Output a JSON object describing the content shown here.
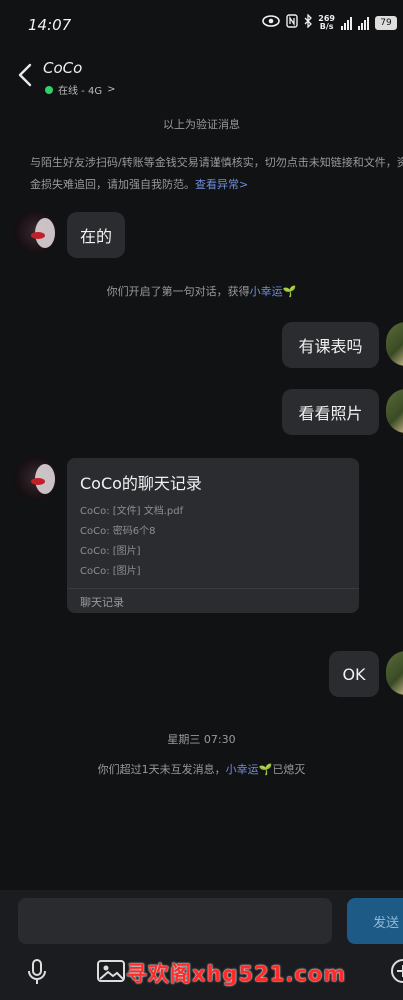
{
  "status": {
    "time": "14:07",
    "net_rate": "269",
    "net_unit": "B/s",
    "battery": "79"
  },
  "header": {
    "contact_name": "CoCo",
    "status_text": "在线 - 4G",
    "status_chevron": ">"
  },
  "messages": {
    "verify_notice": "以上为验证消息",
    "warning_text": "与陌生好友涉扫码/转账等金钱交易请谨慎核实，切勿点击未知链接和文件，资金损失难追回，请加强自我防范。",
    "warning_link": "查看异常>",
    "msg1": "在的",
    "first_chat_notice": "你们开启了第一句对话，获得",
    "lucky_label": "小幸运",
    "msg2": "有课表吗",
    "msg3": "看看照片",
    "card": {
      "title": "CoCo的聊天记录",
      "lines": [
        "CoCo: [文件] 文档.pdf",
        "CoCo: 密码6个8",
        "CoCo: [图片]",
        "CoCo: [图片]"
      ],
      "footer": "聊天记录"
    },
    "msg4": "OK",
    "date_stamp": "星期三 07:30",
    "expired_notice_pre": "你们超过1天未互发消息，",
    "expired_lucky": "小幸运",
    "expired_notice_post": "已熄灭"
  },
  "composer": {
    "send_label": "发送"
  },
  "watermark": "寻欢阁xhg521.com",
  "colors": {
    "accent": "#6f8dd8",
    "online": "#2fd26a",
    "send_bg": "#1e5a86"
  }
}
